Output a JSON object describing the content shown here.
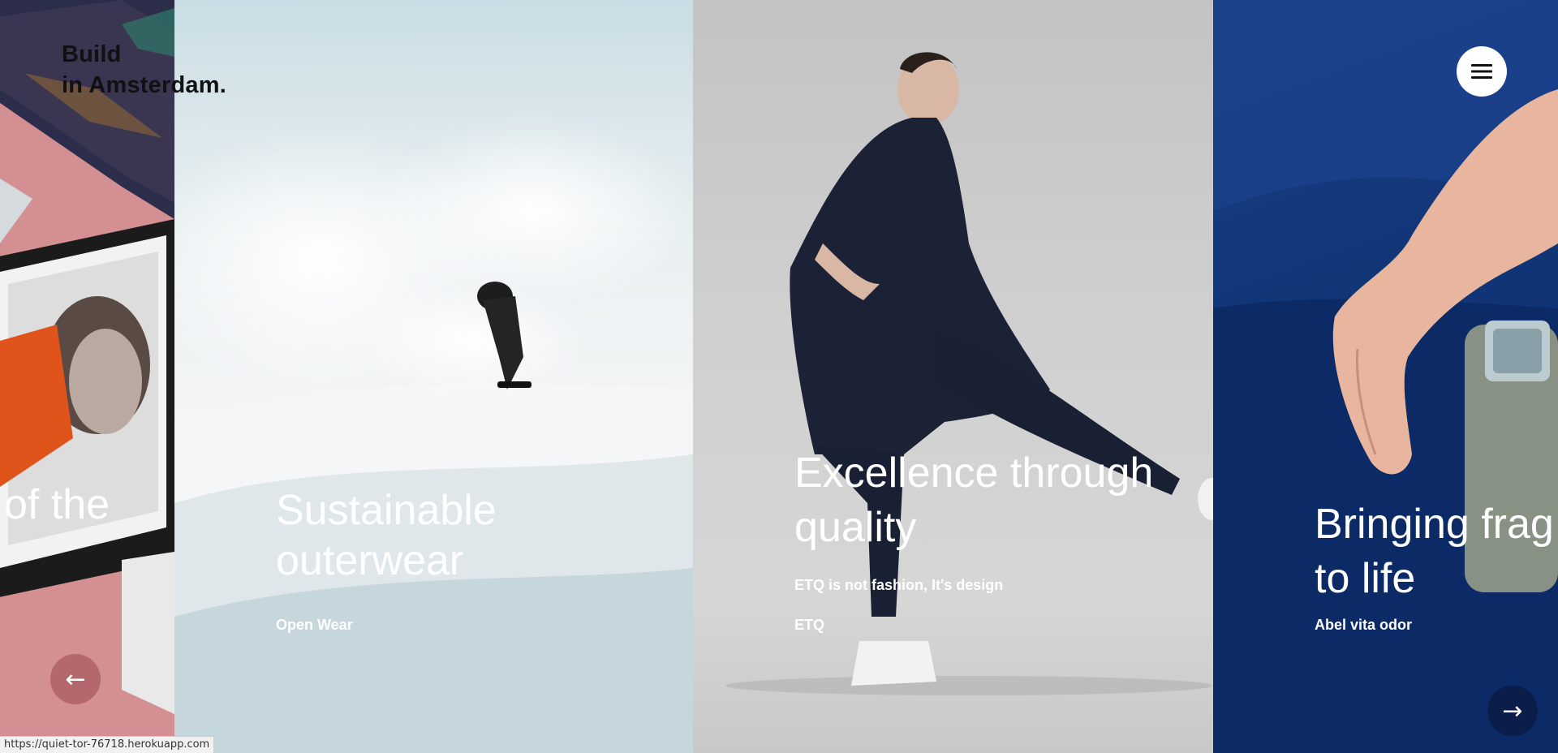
{
  "brand": {
    "line1": "Build",
    "line2": "in Amsterdam."
  },
  "menu": {
    "icon": "hamburger-icon"
  },
  "slides": [
    {
      "title_line1": "of the",
      "title_line2": "",
      "subtitle": "",
      "category": "",
      "image": "magazine-photo"
    },
    {
      "title_line1": "Sustainable",
      "title_line2": "outerwear",
      "subtitle": "",
      "category": "Open Wear",
      "image": "snowboarder-photo"
    },
    {
      "title_line1": "Excellence through",
      "title_line2": "quality",
      "subtitle": "ETQ is not fashion, It's design",
      "category": "ETQ",
      "image": "fashion-model-photo"
    },
    {
      "title_line1": "Bringing frag",
      "title_line2": "to life",
      "subtitle": "",
      "category": "Abel vita odor",
      "image": "perfume-photo"
    }
  ],
  "nav": {
    "prev_label": "←",
    "next_label": "→"
  },
  "status_bar": {
    "url": "https://quiet-tor-76718.herokuapp.com"
  },
  "colors": {
    "panel1_bg": "#d48f92",
    "panel4_bg": "#103577",
    "logo_text": "#111111",
    "slide_text": "#ffffff"
  }
}
